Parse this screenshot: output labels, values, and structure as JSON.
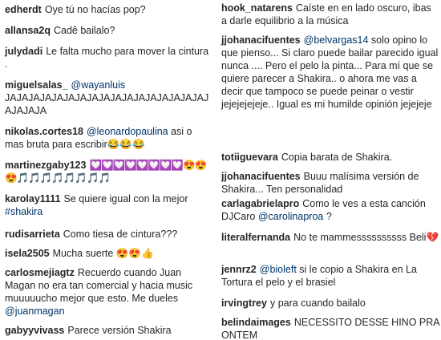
{
  "left": [
    {
      "user": "edherdt",
      "text": "Oye tú no hacías pop?"
    },
    {
      "user": "allansa2q",
      "text": "Cadê bailalo?"
    },
    {
      "user": "julydadi",
      "text": "Le falta mucho para mover la cintura ."
    },
    {
      "user": "miguelsalas_",
      "mention": "@wayanluis",
      "text": "JAJAJAJAJAJAJAJAJAJAJAJAJAJAJAJAJAJAJAJAJA"
    },
    {
      "user": "nikolas.cortes18",
      "mention": "@leonardopaulina",
      "text": "asi o mas bruta para escribir😂😂😂"
    },
    {
      "user": "martinezgaby123",
      "text": "💟💟💟💟💟💟💟💟😍😍😍🎵🎵🎵🎵🎵🎵🎵🎵"
    },
    {
      "user": "karolay1111",
      "text": "Se quiere igual con la mejor",
      "tag": "#shakira"
    },
    {
      "user": "rudisarrieta",
      "text": "Como tiesa de cintura???"
    },
    {
      "user": "isela2505",
      "text": "Mucha suerte 😍😍👍"
    },
    {
      "user": "carlosmejiagtz",
      "text": "Recuerdo cuando Juan Magan no era tan comercial y hacia music muuuuucho mejor que esto. Me dueles",
      "mention2": "@juanmagan"
    },
    {
      "user": "gabyyvivass",
      "text": "Parece versión Shakira"
    }
  ],
  "right": [
    {
      "user": "hook_natarens",
      "text": "Caíste en en lado oscuro, ibas a darle equilibrio a la música"
    },
    {
      "user": "jjohanacifuentes",
      "mention": "@belvargas14",
      "text": "solo opino lo que pienso... Si claro puede bailar parecido igual nunca .... Pero el pelo la pinta... Para mí que se quiere parecer a Shakira.. o ahora me vas a decir que tampoco se puede peinar o vestir jejejejejeje.. Igual es mi humilde opinión jejejeje"
    },
    {
      "user": "totiiguevara",
      "text": "Copia barata de Shakira."
    },
    {
      "user": "jjohanacifuentes",
      "text": "Buuu malísima versión de Shakira... Ten personalidad"
    },
    {
      "user": "carlagabrielapro",
      "text": "Como le ves a esta canción DJCaro",
      "mention2": "@carolinaproa",
      "text2": "?"
    },
    {
      "user": "literalfernanda",
      "text": "No te mammessssssssss Beli💔"
    },
    {
      "user": "jennrz2",
      "mention": "@bioleft",
      "text": "si le copio a Shakira en La Tortura el pelo y el brasiel"
    },
    {
      "user": "irvingtrey",
      "text": "y para cuando bailalo"
    },
    {
      "user": "belindaimages",
      "text": "NECESSITO DESSE HINO PRA ONTEM"
    }
  ]
}
